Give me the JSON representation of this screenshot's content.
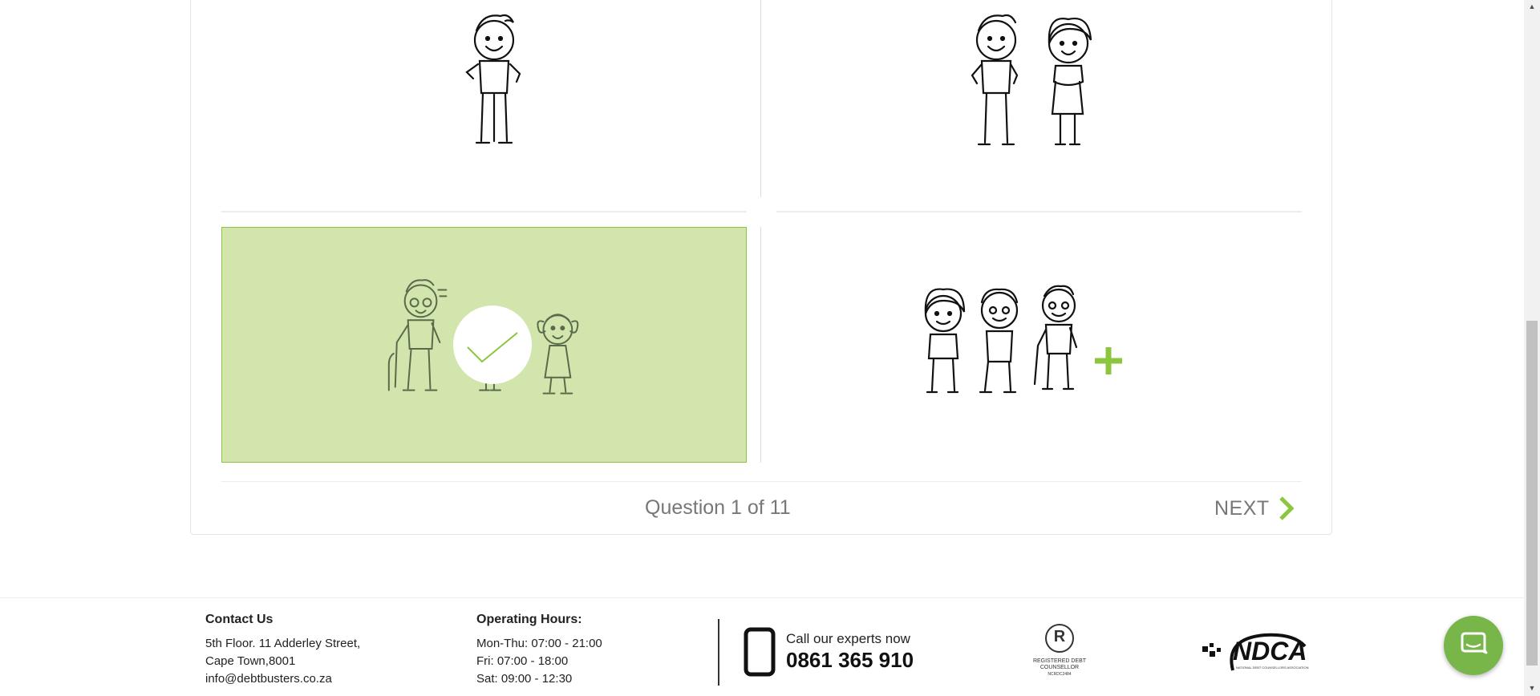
{
  "quiz": {
    "counter": "Question 1 of 11",
    "next_label": "NEXT",
    "options": [
      {
        "id": "single",
        "selected": false
      },
      {
        "id": "couple",
        "selected": false
      },
      {
        "id": "single-parent",
        "selected": true
      },
      {
        "id": "family-plus",
        "selected": false
      }
    ],
    "accent_color": "#8cc63f",
    "selected_bg": "#d1e5ad"
  },
  "footer": {
    "contact_heading": "Contact Us",
    "address_line1": "5th Floor. 11 Adderley Street,",
    "address_line2": "Cape Town,8001",
    "email": "info@debtbusters.co.za",
    "hours_heading": "Operating Hours:",
    "hours_weekday": "Mon-Thu: 07:00 - 21:00",
    "hours_friday": "Fri: 07:00 - 18:00",
    "hours_saturday": "Sat: 09:00 - 12:30",
    "call_text": "Call our experts now",
    "phone": "0861 365 910",
    "reg_logo_symbol": "R",
    "reg_logo_text1": "REGISTERED DEBT",
    "reg_logo_text2": "COUNSELLOR",
    "reg_logo_text3": "NCRDC2484",
    "ndca_logo_text": "NDCA",
    "ndca_logo_subtext": "NATIONAL DEBT COUNSELLORS ASSOCIATION"
  },
  "chat": {
    "icon": "chat-bubble-icon",
    "color": "#78b64a"
  }
}
